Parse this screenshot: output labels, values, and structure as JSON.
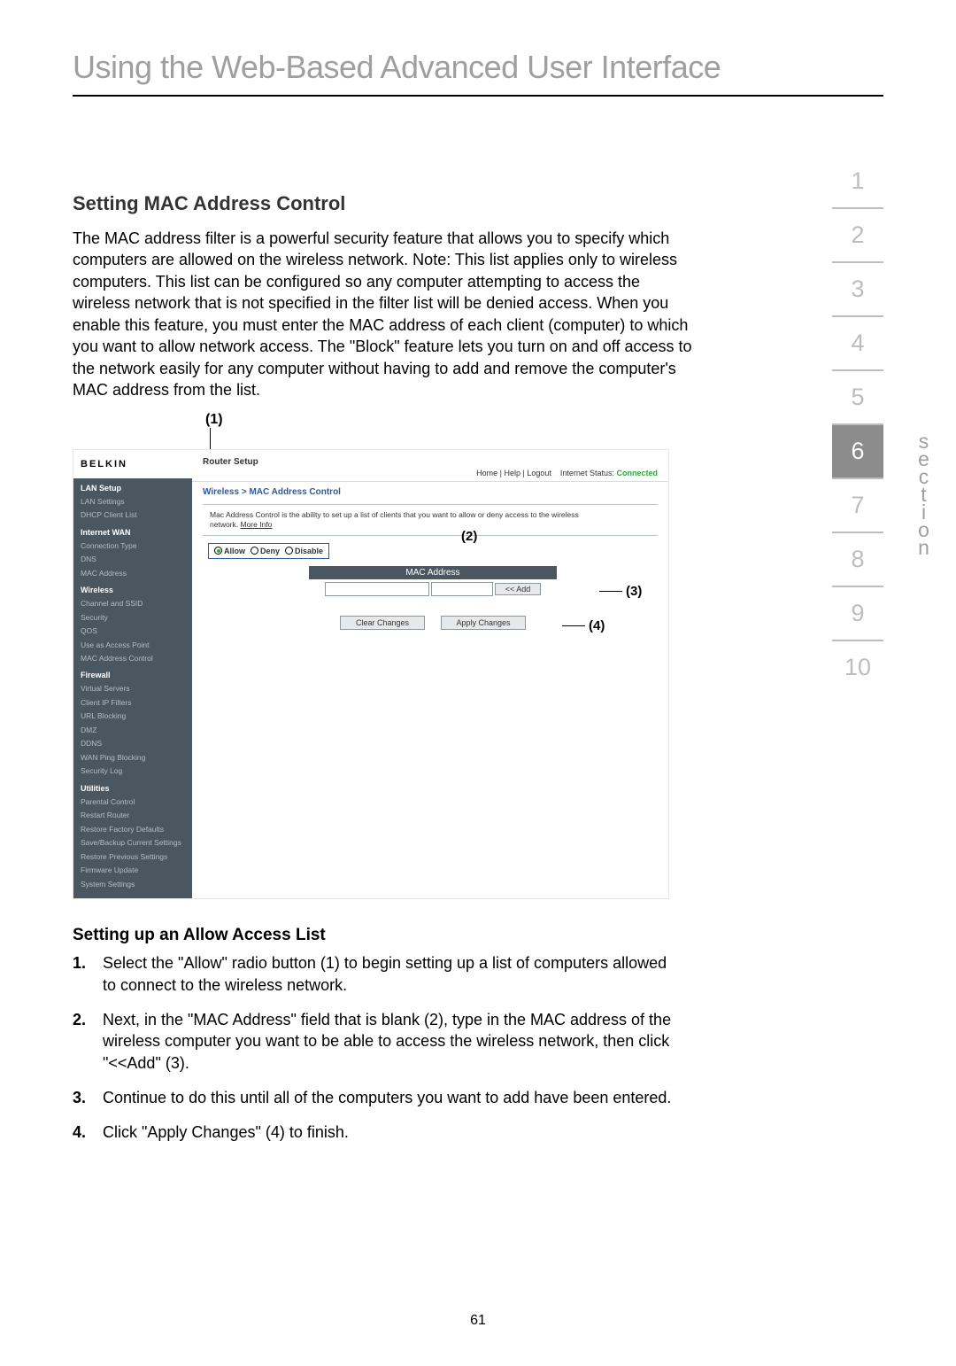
{
  "page_title": "Using the Web-Based Advanced User Interface",
  "section_title": "Setting MAC Address Control",
  "intro": "The MAC address filter is a powerful security feature that allows you to specify which computers are allowed on the wireless network. Note: This list applies only to wireless computers. This list can be configured so any computer attempting to access the wireless network that is not specified in the filter list will be denied access. When you enable this feature, you must enter the MAC address of each client (computer) to which you want to allow network access. The \"Block\" feature lets you turn on and off access to the network easily for any computer without having to add and remove the computer's MAC address from the list.",
  "callouts": {
    "c1": "(1)",
    "c2": "(2)",
    "c3": "(3)",
    "c4": "(4)"
  },
  "shot": {
    "brand": "BELKIN",
    "router_setup": "Router Setup",
    "toplinks_left": "Home | Help | Logout",
    "toplinks_status_label": "Internet Status:",
    "toplinks_status_val": "Connected",
    "crumb": "Wireless > MAC Address Control",
    "desc_a": "Mac Address Control is the ability to set up a list of clients that you want to allow or deny access to the wireless network.",
    "desc_more": "More Info",
    "radios": {
      "allow": "Allow",
      "deny": "Deny",
      "disable": "Disable"
    },
    "mac_header": "MAC Address",
    "add_btn": "<< Add",
    "clear_btn": "Clear Changes",
    "apply_btn": "Apply Changes",
    "nav": {
      "lan_head": "LAN Setup",
      "lan_items": [
        "LAN Settings",
        "DHCP Client List"
      ],
      "wan_head": "Internet WAN",
      "wan_items": [
        "Connection Type",
        "DNS",
        "MAC Address"
      ],
      "wl_head": "Wireless",
      "wl_items": [
        "Channel and SSID",
        "Security",
        "QOS",
        "Use as Access Point",
        "MAC Address Control"
      ],
      "fw_head": "Firewall",
      "fw_items": [
        "Virtual Servers",
        "Client IP Filters",
        "URL Blocking",
        "DMZ",
        "DDNS",
        "WAN Ping Blocking",
        "Security Log"
      ],
      "ut_head": "Utilities",
      "ut_items": [
        "Parental Control",
        "Restart Router",
        "Restore Factory Defaults",
        "Save/Backup Current Settings",
        "Restore Previous Settings",
        "Firmware Update",
        "System Settings"
      ]
    }
  },
  "sub_title": "Setting up an Allow Access List",
  "steps": [
    "Select the \"Allow\" radio button (1) to begin setting up a list of computers allowed to connect to the wireless network.",
    "Next, in the \"MAC Address\" field that is blank (2), type in the MAC address of the wireless computer you want to be able to access the wireless network, then click \"<<Add\" (3).",
    "Continue to do this until all of the computers you want to add have been entered.",
    "Click \"Apply Changes\" (4) to finish."
  ],
  "page_number": "61",
  "tabs": [
    "1",
    "2",
    "3",
    "4",
    "5",
    "6",
    "7",
    "8",
    "9",
    "10"
  ],
  "active_tab_index": 5,
  "section_word": "section"
}
